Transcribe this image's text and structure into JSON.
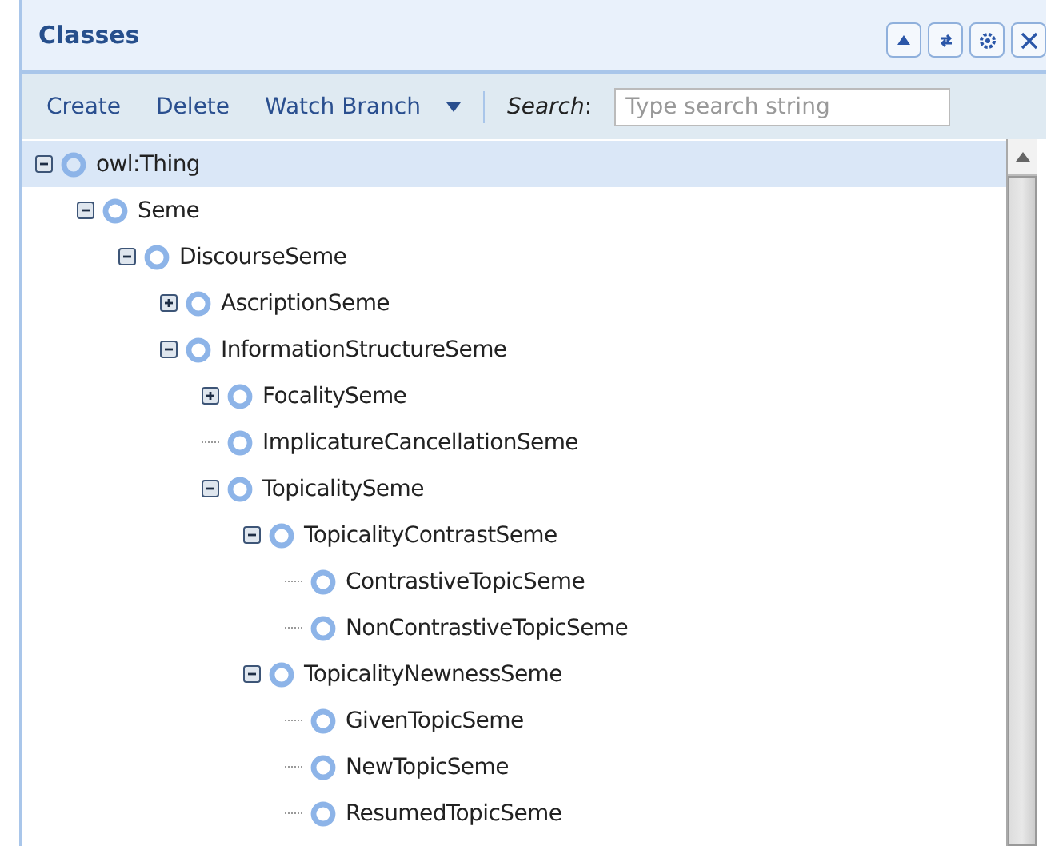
{
  "panel": {
    "title": "Classes"
  },
  "toolbar": {
    "actions": [
      "Create",
      "Delete",
      "Watch Branch"
    ],
    "search_label": "*Search*:",
    "search": {
      "placeholder": "Type search string"
    }
  },
  "tree": [
    {
      "label": "owl:Thing",
      "kind": "branch",
      "expanded": true,
      "selected": true,
      "children": [
        {
          "label": "Seme",
          "kind": "branch",
          "expanded": true,
          "selected": false,
          "children": [
            {
              "label": "DiscourseSeme",
              "kind": "branch",
              "expanded": true,
              "selected": false,
              "children": [
                {
                  "label": "AscriptionSeme",
                  "kind": "branch",
                  "expanded": false,
                  "selected": false
                },
                {
                  "label": "InformationStructureSeme",
                  "kind": "branch",
                  "expanded": true,
                  "selected": false,
                  "children": [
                    {
                      "label": "FocalitySeme",
                      "kind": "branch",
                      "expanded": false,
                      "selected": false
                    },
                    {
                      "label": "ImplicatureCancellationSeme",
                      "kind": "leaf",
                      "selected": false
                    },
                    {
                      "label": "TopicalitySeme",
                      "kind": "branch",
                      "expanded": true,
                      "selected": false,
                      "children": [
                        {
                          "label": "TopicalityContrastSeme",
                          "kind": "branch",
                          "expanded": true,
                          "selected": false,
                          "children": [
                            {
                              "label": "ContrastiveTopicSeme",
                              "kind": "leaf",
                              "selected": false
                            },
                            {
                              "label": "NonContrastiveTopicSeme",
                              "kind": "leaf",
                              "selected": false
                            }
                          ]
                        },
                        {
                          "label": "TopicalityNewnessSeme",
                          "kind": "branch",
                          "expanded": true,
                          "selected": false,
                          "children": [
                            {
                              "label": "GivenTopicSeme",
                              "kind": "leaf",
                              "selected": false
                            },
                            {
                              "label": "NewTopicSeme",
                              "kind": "leaf",
                              "selected": false
                            },
                            {
                              "label": "ResumedTopicSeme",
                              "kind": "leaf",
                              "selected": false
                            }
                          ]
                        }
                      ]
                    }
                  ]
                }
              ]
            }
          ]
        }
      ]
    }
  ]
}
